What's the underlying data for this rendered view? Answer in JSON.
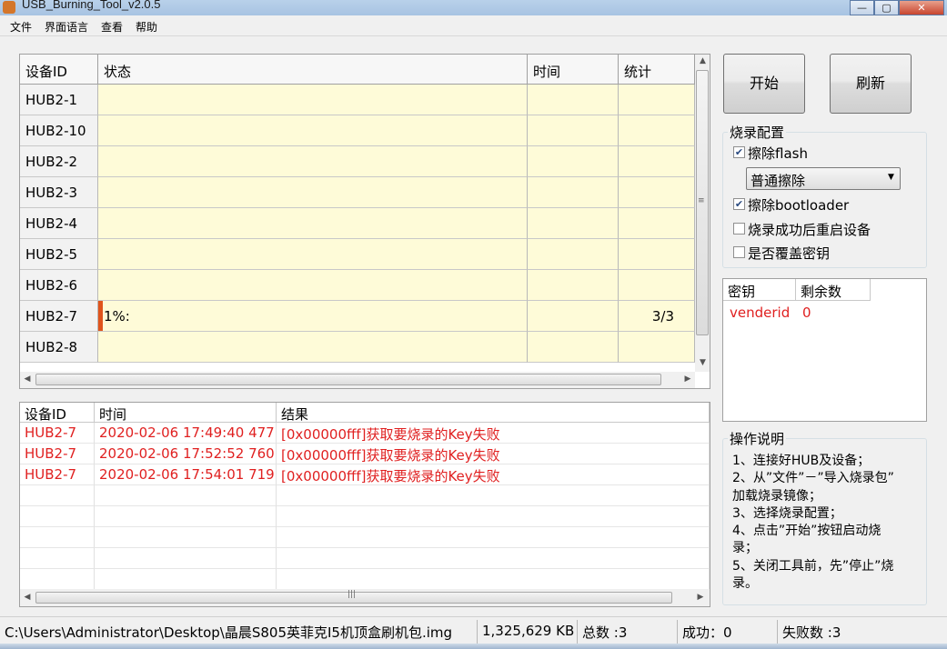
{
  "window": {
    "title": "USB_Burning_Tool_v2.0.5"
  },
  "menu": [
    "文件",
    "界面语言",
    "查看",
    "帮助"
  ],
  "device_table": {
    "headers": [
      "设备ID",
      "状态",
      "时间",
      "统计"
    ],
    "rows": [
      {
        "id": "HUB2-1",
        "status": "",
        "time": "",
        "stats": ""
      },
      {
        "id": "HUB2-10",
        "status": "",
        "time": "",
        "stats": ""
      },
      {
        "id": "HUB2-2",
        "status": "",
        "time": "",
        "stats": ""
      },
      {
        "id": "HUB2-3",
        "status": "",
        "time": "",
        "stats": ""
      },
      {
        "id": "HUB2-4",
        "status": "",
        "time": "",
        "stats": ""
      },
      {
        "id": "HUB2-5",
        "status": "",
        "time": "",
        "stats": ""
      },
      {
        "id": "HUB2-6",
        "status": "",
        "time": "",
        "stats": ""
      },
      {
        "id": "HUB2-7",
        "status": "1%:",
        "time": "",
        "stats": "3/3",
        "progress_fraction": 0.01
      },
      {
        "id": "HUB2-8",
        "status": "",
        "time": "",
        "stats": ""
      }
    ]
  },
  "log_table": {
    "headers": [
      "设备ID",
      "时间",
      "结果"
    ],
    "rows": [
      {
        "id": "HUB2-7",
        "time": "2020-02-06 17:49:40 477",
        "result": "[0x00000fff]获取要烧录的Key失败"
      },
      {
        "id": "HUB2-7",
        "time": "2020-02-06 17:52:52 760",
        "result": "[0x00000fff]获取要烧录的Key失败"
      },
      {
        "id": "HUB2-7",
        "time": "2020-02-06 17:54:01 719",
        "result": "[0x00000fff]获取要烧录的Key失败"
      }
    ]
  },
  "buttons": {
    "start": "开始",
    "refresh": "刷新"
  },
  "burn_config": {
    "title": "烧录配置",
    "erase_flash": {
      "label": "擦除flash",
      "checked": true
    },
    "erase_mode": "普通擦除",
    "erase_bootloader": {
      "label": "擦除bootloader",
      "checked": true
    },
    "reboot_after": {
      "label": "烧录成功后重启设备",
      "checked": false
    },
    "overwrite_key": {
      "label": "是否覆盖密钥",
      "checked": false
    }
  },
  "key_table": {
    "headers": [
      "密钥",
      "剩余数"
    ],
    "rows": [
      {
        "key": "venderid",
        "remaining": "0"
      }
    ]
  },
  "instructions": {
    "title": "操作说明",
    "lines": [
      "1、连接好HUB及设备；",
      "2、从”文件”－”导入烧录包”",
      "加载烧录镜像；",
      "3、选择烧录配置；",
      "4、点击”开始”按钮启动烧",
      "录；",
      "5、关闭工具前，先”停止”烧",
      "录。"
    ]
  },
  "status_bar": {
    "path": "C:\\Users\\Administrator\\Desktop\\晶晨S805英菲克I5机顶盒刷机包.img",
    "size": "1,325,629 KB",
    "total": "总数 :3",
    "success": "成功：0",
    "failed": "失败数 :3"
  },
  "colors": {
    "progress": "#e0541c",
    "error_text": "#e02020",
    "grid_yellow": "#fefbd8"
  }
}
